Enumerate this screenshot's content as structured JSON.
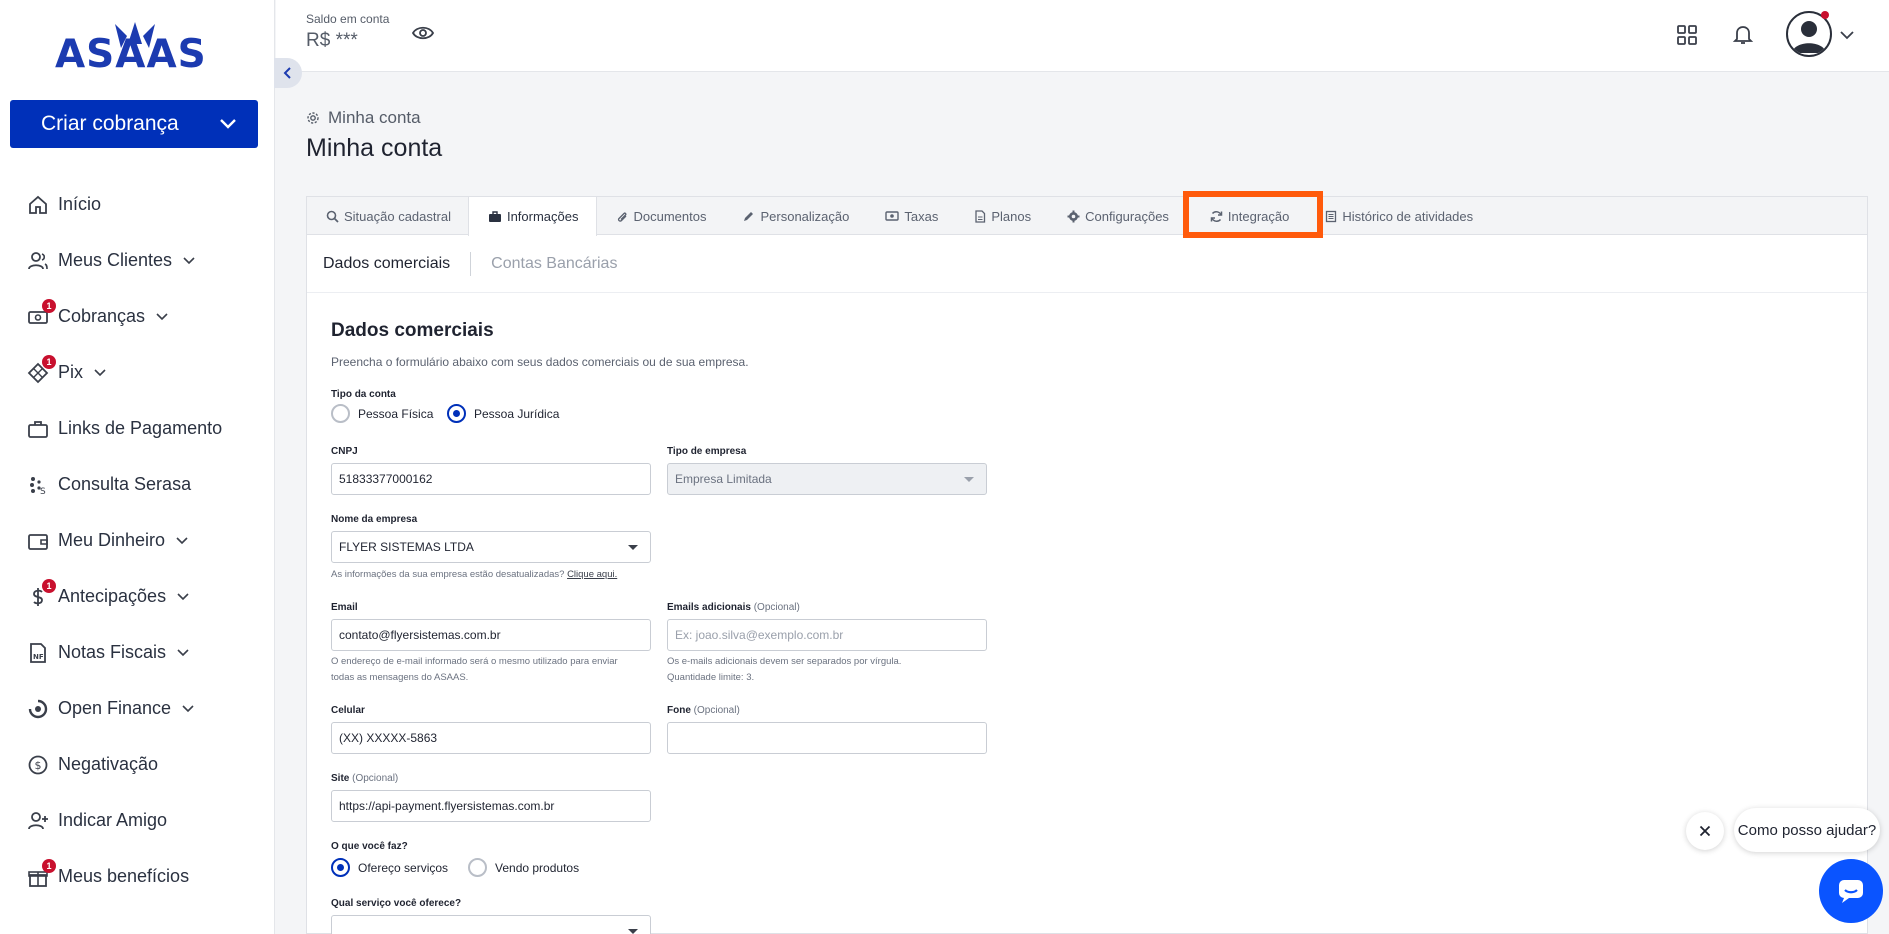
{
  "brand": {
    "logo_text": "ASAAS",
    "primary_color": "#0030b9",
    "highlight_color": "#ff5a0b"
  },
  "sidebar": {
    "create_button": "Criar cobrança",
    "items": [
      {
        "label": "Início",
        "icon": "home-icon",
        "chevron": false,
        "badge": ""
      },
      {
        "label": "Meus Clientes",
        "icon": "users-icon",
        "chevron": true,
        "badge": ""
      },
      {
        "label": "Cobranças",
        "icon": "money-icon",
        "chevron": true,
        "badge": "1"
      },
      {
        "label": "Pix",
        "icon": "pix-icon",
        "chevron": true,
        "badge": "1"
      },
      {
        "label": "Links de Pagamento",
        "icon": "briefcase-icon",
        "chevron": false,
        "badge": ""
      },
      {
        "label": "Consulta Serasa",
        "icon": "serasa-icon",
        "chevron": false,
        "badge": ""
      },
      {
        "label": "Meu Dinheiro",
        "icon": "wallet-icon",
        "chevron": true,
        "badge": ""
      },
      {
        "label": "Antecipações",
        "icon": "dollar-icon",
        "chevron": true,
        "badge": "1"
      },
      {
        "label": "Notas Fiscais",
        "icon": "invoice-icon",
        "chevron": true,
        "badge": ""
      },
      {
        "label": "Open Finance",
        "icon": "open-finance-icon",
        "chevron": true,
        "badge": ""
      },
      {
        "label": "Negativação",
        "icon": "negativacao-icon",
        "chevron": false,
        "badge": ""
      },
      {
        "label": "Indicar Amigo",
        "icon": "user-plus-icon",
        "chevron": false,
        "badge": ""
      },
      {
        "label": "Meus benefícios",
        "icon": "gift-icon",
        "chevron": false,
        "badge": "1"
      }
    ]
  },
  "topbar": {
    "balance_label": "Saldo em conta",
    "balance_value": "R$ ***"
  },
  "page": {
    "breadcrumb": "Minha conta",
    "title": "Minha conta"
  },
  "tabs": [
    {
      "label": "Situação cadastral",
      "icon": "search-icon",
      "active": false
    },
    {
      "label": "Informações",
      "icon": "briefcase-icon",
      "active": true
    },
    {
      "label": "Documentos",
      "icon": "paperclip-icon",
      "active": false
    },
    {
      "label": "Personalização",
      "icon": "pencil-icon",
      "active": false
    },
    {
      "label": "Taxas",
      "icon": "money-icon",
      "active": false
    },
    {
      "label": "Planos",
      "icon": "document-icon",
      "active": false
    },
    {
      "label": "Configurações",
      "icon": "gear-icon",
      "active": false
    },
    {
      "label": "Integração",
      "icon": "sync-icon",
      "active": false
    },
    {
      "label": "Histórico de atividades",
      "icon": "history-icon",
      "active": false
    }
  ],
  "subtabs": {
    "active": "Dados comerciais",
    "inactive": "Contas Bancárias"
  },
  "form": {
    "title": "Dados comerciais",
    "description": "Preencha o formulário abaixo com seus dados comerciais ou de sua empresa.",
    "account_type": {
      "label": "Tipo da conta",
      "option_pf": "Pessoa Física",
      "option_pj": "Pessoa Jurídica",
      "selected": "Pessoa Jurídica"
    },
    "cnpj": {
      "label": "CNPJ",
      "value": "51833377000162"
    },
    "company_type": {
      "label": "Tipo de empresa",
      "value": "Empresa Limitada"
    },
    "company_name": {
      "label": "Nome da empresa",
      "value": "FLYER SISTEMAS LTDA",
      "help": "As informações da sua empresa estão desatualizadas?",
      "help_link": "Clique aqui."
    },
    "email": {
      "label": "Email",
      "value": "contato@flyersistemas.com.br",
      "help_1": "O endereço de e-mail informado será o mesmo utilizado para enviar",
      "help_2": "todas as mensagens do ASAAS."
    },
    "extra_emails": {
      "label": "Emails adicionais",
      "optional": "(Opcional)",
      "placeholder": "Ex: joao.silva@exemplo.com.br",
      "help_1": "Os e-mails adicionais devem ser separados por vírgula.",
      "help_2": "Quantidade limite: 3."
    },
    "cellphone": {
      "label": "Celular",
      "value": "(XX) XXXXX-5863"
    },
    "phone": {
      "label": "Fone",
      "optional": "(Opcional)",
      "value": ""
    },
    "site": {
      "label": "Site",
      "optional": "(Opcional)",
      "value": "https://api-payment.flyersistemas.com.br"
    },
    "what_you_do": {
      "label": "O que você faz?",
      "option_services": "Ofereço serviços",
      "option_products": "Vendo produtos",
      "selected": "Ofereço serviços"
    },
    "service_offered": {
      "label": "Qual serviço você oferece?"
    }
  },
  "chat": {
    "prompt": "Como posso ajudar?"
  }
}
